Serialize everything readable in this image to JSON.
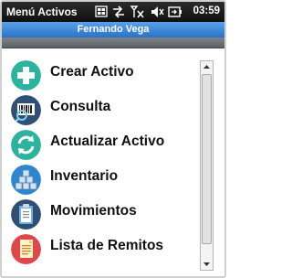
{
  "titlebar": {
    "app_title": "Menú Activos",
    "time": "03:59",
    "status_icons": [
      "windows-flag-icon",
      "sync-icon",
      "no-signal-icon",
      "volume-icon",
      "battery-icon"
    ]
  },
  "user": {
    "name": "Fernando Vega"
  },
  "menu": {
    "items": [
      {
        "label": "Crear Activo",
        "icon": "plus-icon",
        "color": "#2bb39d"
      },
      {
        "label": "Consulta",
        "icon": "barcode-search-icon",
        "color": "#2f4f75"
      },
      {
        "label": "Actualizar Activo",
        "icon": "refresh-icon",
        "color": "#2bb39d"
      },
      {
        "label": "Inventario",
        "icon": "boxes-icon",
        "color": "#2d86d1"
      },
      {
        "label": "Movimientos",
        "icon": "clipboard-icon",
        "color": "#2f4f75"
      },
      {
        "label": "Lista de Remitos",
        "icon": "document-list-icon",
        "color": "#e0474b"
      }
    ]
  },
  "colors": {
    "titlebar_bg": "#1a1a1a",
    "userbar_bg": "#3d86d8",
    "graybar_bg": "#6b7176"
  }
}
